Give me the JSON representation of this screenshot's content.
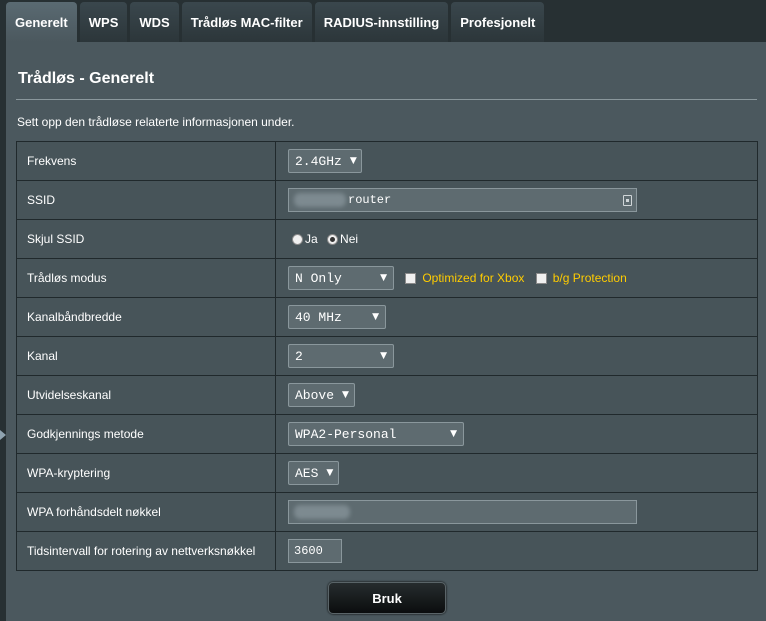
{
  "tabs": [
    {
      "label": "Generelt",
      "active": true
    },
    {
      "label": "WPS"
    },
    {
      "label": "WDS"
    },
    {
      "label": "Trådløs MAC-filter"
    },
    {
      "label": "RADIUS-innstilling"
    },
    {
      "label": "Profesjonelt"
    }
  ],
  "panel": {
    "title": "Trådløs - Generelt",
    "description": "Sett opp den trådløse relaterte informasjonen under."
  },
  "form": {
    "frequency": {
      "label": "Frekvens",
      "value": "2.4GHz"
    },
    "ssid": {
      "label": "SSID",
      "value": "router"
    },
    "hide_ssid": {
      "label": "Skjul SSID",
      "options": [
        "Ja",
        "Nei"
      ],
      "selected": "Nei"
    },
    "wireless_mode": {
      "label": "Trådløs modus",
      "value": "N Only",
      "xbox_label": "Optimized for Xbox",
      "bg_label": "b/g Protection"
    },
    "bandwidth": {
      "label": "Kanalbåndbredde",
      "value": "40 MHz"
    },
    "channel": {
      "label": "Kanal",
      "value": "2"
    },
    "ext_channel": {
      "label": "Utvidelseskanal",
      "value": "Above"
    },
    "auth_method": {
      "label": "Godkjennings metode",
      "value": "WPA2-Personal"
    },
    "wpa_encryption": {
      "label": "WPA-kryptering",
      "value": "AES"
    },
    "wpa_key": {
      "label": "WPA forhåndsdelt nøkkel",
      "value": ""
    },
    "key_rotation": {
      "label": "Tidsintervall for rotering av nettverksnøkkel",
      "value": "3600"
    }
  },
  "apply_label": "Bruk",
  "colors": {
    "accent_text": "#ffcc00",
    "panel_bg": "#4b585e",
    "page_bg": "#273033"
  }
}
